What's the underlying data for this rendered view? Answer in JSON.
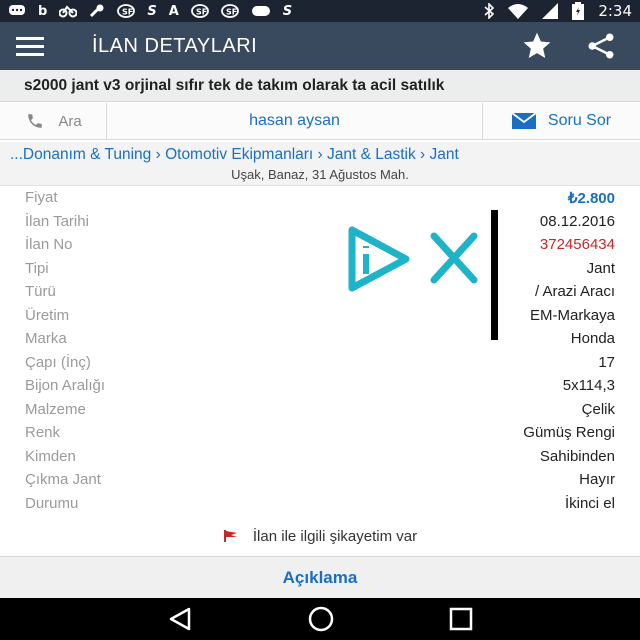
{
  "status_bar": {
    "time": "2:34",
    "icons": [
      "chat-icon",
      "b-icon",
      "bike-icon",
      "wrench-icon",
      "sf-icon",
      "s-icon",
      "a-icon",
      "sf-icon",
      "sf-icon",
      "yoo-icon",
      "s-icon",
      "bluetooth-icon",
      "wifi-icon",
      "signal-icon",
      "battery-icon"
    ],
    "left_glyphs": [
      "b",
      "S",
      "A",
      "S"
    ]
  },
  "app_bar": {
    "title": "İLAN DETAYLARI",
    "icons": [
      "menu-icon",
      "star-icon",
      "share-icon"
    ]
  },
  "listing": {
    "title": "s2000 jant v3 orjinal sıfır tek de takım olarak ta acil satılık"
  },
  "contact": {
    "call_label": "Ara",
    "seller_name": "hasan aysan",
    "ask_label": "Soru Sor"
  },
  "breadcrumb": {
    "path": "...Donanım & Tuning › Otomotiv Ekipmanları › Jant & Lastik › Jant",
    "location": "Uşak, Banaz, 31 Ağustos Mah."
  },
  "details": [
    {
      "label": "Fiyat",
      "value": "₺2.800"
    },
    {
      "label": "İlan Tarihi",
      "value": "08.12.2016"
    },
    {
      "label": "İlan No",
      "value": "372456434"
    },
    {
      "label": "Tipi",
      "value": "Jant"
    },
    {
      "label": "Türü",
      "value": "/ Arazi Aracı"
    },
    {
      "label": "Üretim",
      "value": "EM-Markaya"
    },
    {
      "label": "Marka",
      "value": "Honda"
    },
    {
      "label": "Çapı (İnç)",
      "value": "17"
    },
    {
      "label": "Bijon Aralığı",
      "value": "5x114,3"
    },
    {
      "label": "Malzeme",
      "value": "Çelik"
    },
    {
      "label": "Renk",
      "value": "Gümüş Rengi"
    },
    {
      "label": "Kimden",
      "value": "Sahibinden"
    },
    {
      "label": "Çıkma Jant",
      "value": "Hayır"
    },
    {
      "label": "Durumu",
      "value": "İkinci el"
    }
  ],
  "complaint": {
    "label": "İlan ile ilgili şikayetim var"
  },
  "description": {
    "label": "Açıklama"
  },
  "colors": {
    "status_bar": "#1c2431",
    "app_bar": "#3a4a5e",
    "link_blue": "#1a6fc2",
    "price_blue": "#1a6fc2",
    "ad_number_red": "#c62828",
    "ad_icon_teal": "#1fb3c7"
  }
}
